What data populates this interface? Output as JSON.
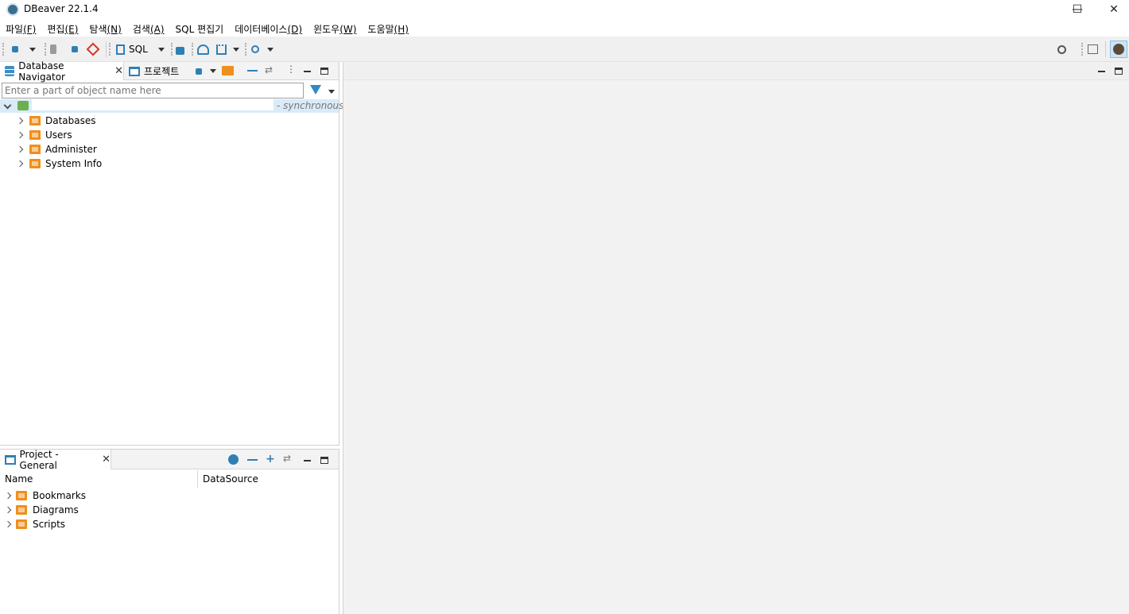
{
  "window": {
    "title": "DBeaver 22.1.4",
    "minimize": "—",
    "maximize": "☐",
    "close": "✕"
  },
  "menubar": {
    "items": [
      {
        "label": "파일",
        "mnemonic": "(F)"
      },
      {
        "label": "편집",
        "mnemonic": "(E)"
      },
      {
        "label": "탐색",
        "mnemonic": "(N)"
      },
      {
        "label": "검색",
        "mnemonic": "(A)"
      },
      {
        "label": "SQL 편집기",
        "mnemonic": ""
      },
      {
        "label": "데이터베이스",
        "mnemonic": "(D)"
      },
      {
        "label": "윈도우",
        "mnemonic": "(W)"
      },
      {
        "label": "도움말",
        "mnemonic": "(H)"
      }
    ]
  },
  "toolbar": {
    "sql_label": "SQL",
    "search_glyph": "⚲"
  },
  "navigator": {
    "tab_label": "Database Navigator",
    "project_tab_label": "프로젝트",
    "search_placeholder": "Enter a part of object name here",
    "connection_status": "- synchronous",
    "nodes": [
      {
        "label": "Databases"
      },
      {
        "label": "Users"
      },
      {
        "label": "Administer"
      },
      {
        "label": "System Info"
      }
    ]
  },
  "project_panel": {
    "tab_label": "Project - General",
    "columns": [
      "Name",
      "DataSource"
    ],
    "nodes": [
      {
        "label": "Bookmarks"
      },
      {
        "label": "Diagrams"
      },
      {
        "label": "Scripts"
      }
    ]
  },
  "colors": {
    "accent_blue": "#2f7fb4",
    "folder_orange": "#ef8f1c",
    "selection": "#d9ebf8"
  }
}
